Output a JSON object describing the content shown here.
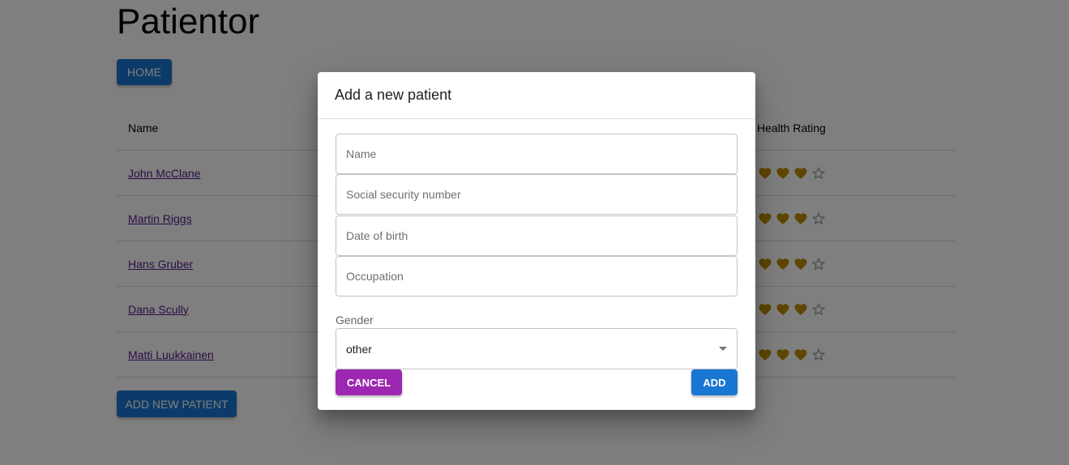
{
  "app": {
    "title": "Patientor"
  },
  "nav": {
    "home_label": "HOME"
  },
  "table": {
    "headers": {
      "name": "Name",
      "health_rating": "Health Rating"
    },
    "rows": [
      {
        "name": "John McClane",
        "rating": 3,
        "max": 4
      },
      {
        "name": "Martin Riggs",
        "rating": 3,
        "max": 4
      },
      {
        "name": "Hans Gruber",
        "rating": 3,
        "max": 4
      },
      {
        "name": "Dana Scully",
        "rating": 3,
        "max": 4
      },
      {
        "name": "Matti Luukkainen",
        "rating": 3,
        "max": 4
      }
    ]
  },
  "add_patient_label": "ADD NEW PATIENT",
  "modal": {
    "title": "Add a new patient",
    "fields": {
      "name_placeholder": "Name",
      "ssn_placeholder": "Social security number",
      "dob_placeholder": "Date of birth",
      "occupation_placeholder": "Occupation"
    },
    "gender_label": "Gender",
    "gender_value": "other",
    "cancel_label": "CANCEL",
    "add_label": "ADD"
  },
  "colors": {
    "primary": "#1976d2",
    "secondary": "#9c27b0",
    "heart": "#bf8f00",
    "star": "#9e9e9e"
  },
  "icons": {
    "rating_filled": "heart-icon",
    "rating_empty": "star-outline-icon",
    "select_caret": "caret-down-icon"
  }
}
